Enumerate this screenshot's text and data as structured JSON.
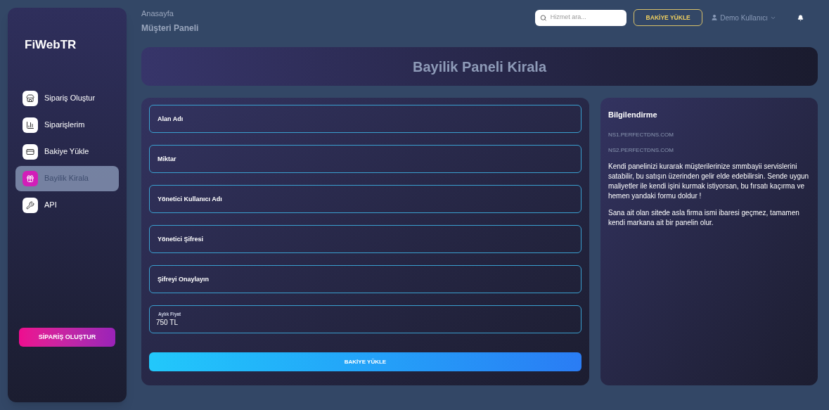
{
  "sidebar": {
    "logo": "FiWebTR",
    "items": [
      {
        "label": "Sipariş Oluştur",
        "kind": "store",
        "selected": false
      },
      {
        "label": "Siparişlerim",
        "kind": "chart",
        "selected": false
      },
      {
        "label": "Bakiye Yükle",
        "kind": "card",
        "selected": false
      },
      {
        "label": "Bayilik Kirala",
        "kind": "gift",
        "selected": true
      },
      {
        "label": "API",
        "kind": "tools",
        "selected": false
      }
    ],
    "button": "SİPARİŞ OLUŞTUR"
  },
  "header": {
    "breadcrumb": "Anasayfa",
    "title": "Müşteri Paneli",
    "search": {
      "placeholder": "Hizmet ara..."
    },
    "balance_button": "BAKİYE YÜKLE",
    "user": "Demo Kullanıcı"
  },
  "page_title": "Bayilik Paneli Kirala",
  "form": {
    "fields": [
      {
        "placeholder": "Alan Adı"
      },
      {
        "placeholder": "Miktar"
      },
      {
        "placeholder": "Yönetici Kullanıcı Adı"
      },
      {
        "placeholder": "Yönetici Şifresi"
      },
      {
        "placeholder": "Şifreyi Onaylayın"
      },
      {
        "label": "Aylık Fiyat",
        "value": "750 TL"
      }
    ],
    "submit": "BAKİYE YÜKLE"
  },
  "info": {
    "title": "Bilgilendirme",
    "nameservers": [
      "NS1.PERFECTDNS.COM",
      "NS2.PERFECTDNS.COM"
    ],
    "paragraphs": [
      "Kendi panelinizi kurarak müşterilerinize smmbayii servislerini satabilir, bu satışın üzerinden gelir elde edebilirsin. Sende uygun maliyetler ile kendi işini kurmak istiyorsan, bu fırsatı kaçırma ve hemen yandaki formu doldur !",
      "Sana ait olan sitede asla firma ismi ibaresi geçmez, tamamen kendi markana ait bir panelin olur."
    ]
  }
}
